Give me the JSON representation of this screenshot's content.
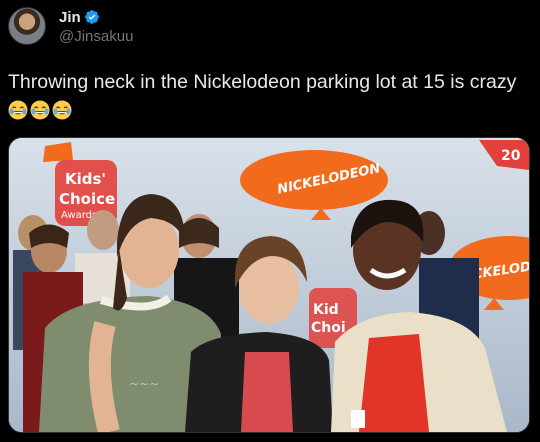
{
  "tweet": {
    "author": {
      "display_name": "Jin",
      "handle": "@Jinsakuu",
      "verified_icon": "verified-badge-icon",
      "avatar_icon": "avatar-image"
    },
    "text": "Throwing neck in the Nickelodeon parking lot at 15 is crazy",
    "emojis": [
      "😂",
      "😂",
      "😂"
    ],
    "media": {
      "backdrop_texts": [
        "Kids' Choice Awards",
        "NICKELODEON",
        "NICKELOD",
        "Kid Choi",
        "20",
        "20"
      ],
      "colors": {
        "backdrop": "#c7d2df",
        "blimp": "#f26b1d"
      }
    }
  }
}
